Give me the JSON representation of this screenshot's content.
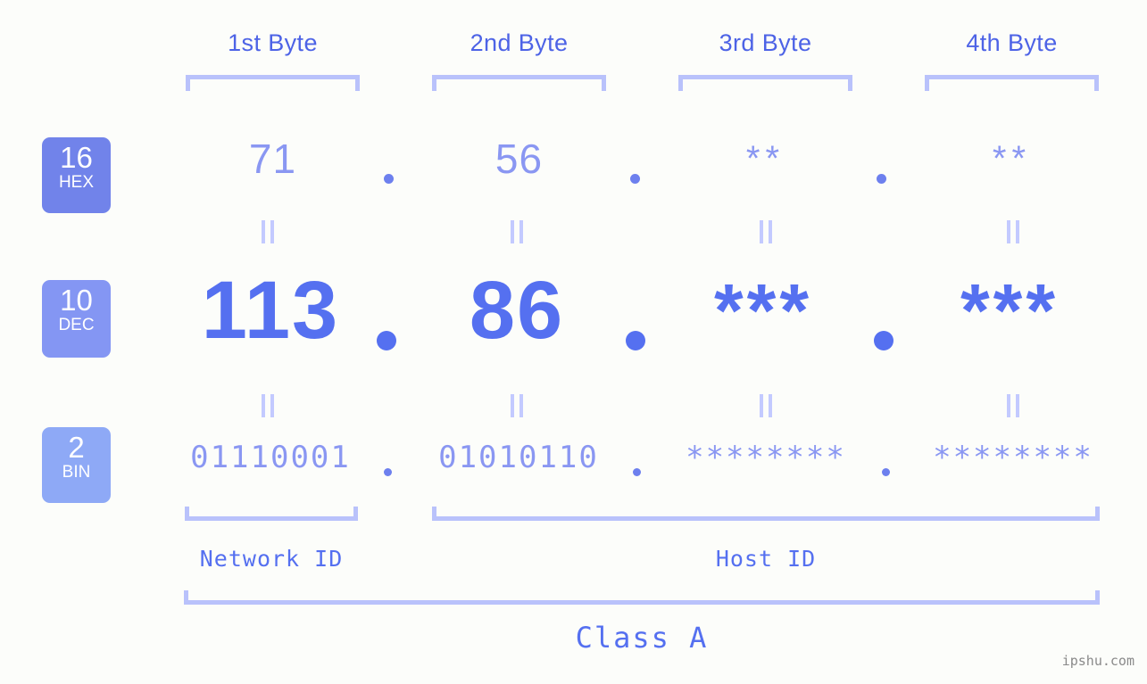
{
  "meta": {
    "background_color": "#fcfdfa",
    "accent_color": "#5570f0",
    "light_accent_color": "#b9c2fb",
    "watermark": "ipshu.com"
  },
  "header": {
    "byte_labels": [
      "1st Byte",
      "2nd Byte",
      "3rd Byte",
      "4th Byte"
    ]
  },
  "bases": [
    {
      "number": "16",
      "abbr": "HEX",
      "color": "#7183ea"
    },
    {
      "number": "10",
      "abbr": "DEC",
      "color": "#8496f3"
    },
    {
      "number": "2",
      "abbr": "BIN",
      "color": "#8ea9f6"
    }
  ],
  "rows": {
    "hex": {
      "base_number": "16",
      "base_abbr": "HEX",
      "values": [
        "71",
        "56",
        "**",
        "**"
      ],
      "separator": "."
    },
    "dec": {
      "base_number": "10",
      "base_abbr": "DEC",
      "values": [
        "113",
        "86",
        "***",
        "***"
      ],
      "separator": "."
    },
    "bin": {
      "base_number": "2",
      "base_abbr": "BIN",
      "values": [
        "01110001",
        "01010110",
        "********",
        "********"
      ],
      "separator": "."
    }
  },
  "equality": {
    "symbol": "||"
  },
  "footer": {
    "network_id_label": "Network ID",
    "host_id_label": "Host ID",
    "class_label": "Class A"
  }
}
